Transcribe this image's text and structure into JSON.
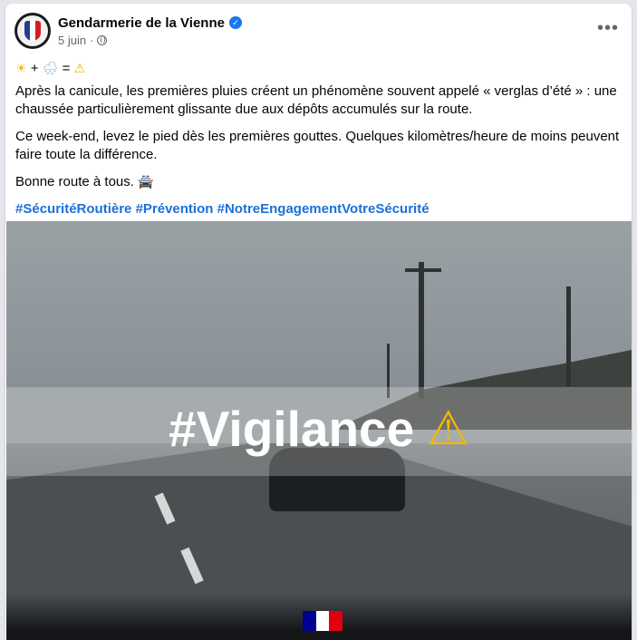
{
  "post": {
    "page_name": "Gendarmerie de la Vienne",
    "date": "5 juin",
    "emoji_line": {
      "a": "☀",
      "plus": "+",
      "b": "🌧",
      "eq": "=",
      "c": "⚠"
    },
    "paragraph1": "Après la canicule, les premières pluies créent un phénomène souvent appelé « verglas d’été » : une chaussée particulièrement glissante due aux dépôts accumulés sur la route.",
    "paragraph2": "Ce week-end, levez le pied dès les premières gouttes. Quelques kilomètres/heure de moins peuvent faire toute la différence.",
    "paragraph3": "Bonne route à tous.",
    "car_emoji": "🚔",
    "hashtags": [
      "#SécuritéRoutière",
      "#Prévention",
      "#NotreEngagementVotreSécurité"
    ]
  },
  "image": {
    "overlay_text": "#Vigilance",
    "warning_glyph": "⚠"
  },
  "colors": {
    "hashtag": "#1d6fd8",
    "verified": "#1877f2",
    "warning": "#f3b800",
    "flag_blue": "#000091",
    "flag_red": "#e1000f"
  },
  "icons": [
    "verified-badge-icon",
    "globe-icon",
    "more-options-icon",
    "marianne-logo"
  ]
}
